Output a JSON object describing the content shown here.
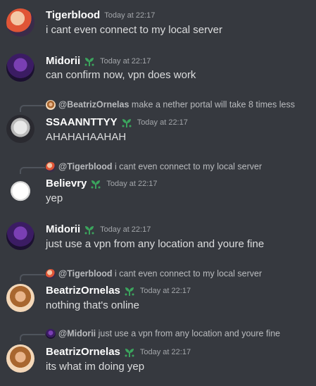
{
  "messages": [
    {
      "author": "Tigerblood",
      "time": "Today at 22:17",
      "text": "i cant even connect to my local server",
      "badge": false
    },
    {
      "author": "Midorii",
      "time": "Today at 22:17",
      "text": "can confirm now, vpn does work",
      "badge": true
    },
    {
      "author": "SSAANNTTYY",
      "time": "Today at 22:17",
      "text": "AHAHAHAAHAH",
      "badge": true,
      "reply": {
        "mention": "@BeatrizOrnelas",
        "text": "make a nether portal will take 8 times less"
      }
    },
    {
      "author": "Believry",
      "time": "Today at 22:17",
      "text": "yep",
      "badge": true,
      "reply": {
        "mention": "@Tigerblood",
        "text": "i cant even connect to my local server"
      }
    },
    {
      "author": "Midorii",
      "time": "Today at 22:17",
      "text": "just use a vpn from any location and youre fine",
      "badge": true
    },
    {
      "author": "BeatrizOrnelas",
      "time": "Today at 22:17",
      "text": "nothing that's online",
      "badge": true,
      "reply": {
        "mention": "@Tigerblood",
        "text": "i cant even connect to my local server"
      }
    },
    {
      "author": "BeatrizOrnelas",
      "time": "Today at 22:17",
      "text": "its what im doing yep",
      "badge": true,
      "reply": {
        "mention": "@Midorii",
        "text": "just use a vpn from any location and youre fine"
      }
    }
  ],
  "colors": {
    "background": "#36393f",
    "username": "#ffffff",
    "message_text": "#dcddde",
    "timestamp": "#a3a6aa",
    "badge": "#3ba55d"
  },
  "icons": {
    "badge": "sprout-badge-icon"
  }
}
